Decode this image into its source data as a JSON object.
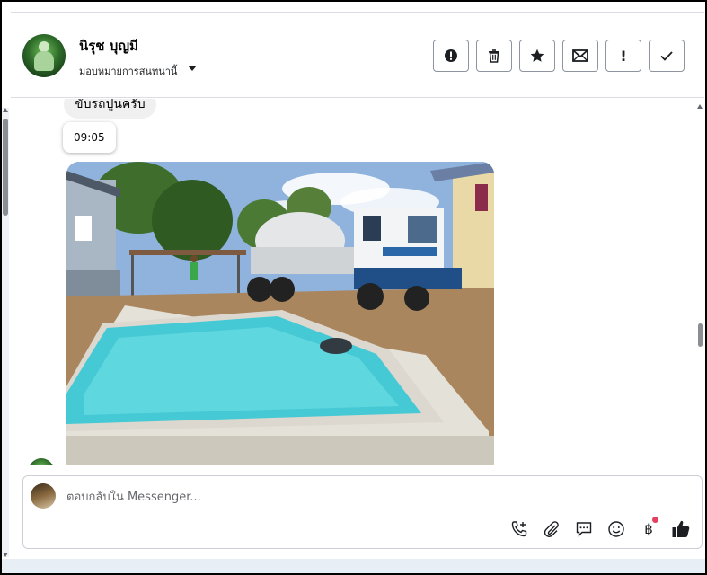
{
  "contact": {
    "name": "นิรุช บุญมี",
    "assign_label": "มอบหมายการสนทนานี้"
  },
  "header_actions": [
    {
      "name": "alert-circle-button",
      "icon": "alert-circle-icon"
    },
    {
      "name": "delete-button",
      "icon": "trash-icon"
    },
    {
      "name": "star-button",
      "icon": "star-icon"
    },
    {
      "name": "mail-button",
      "icon": "envelope-icon"
    },
    {
      "name": "mark-important-button",
      "icon": "exclamation-icon",
      "glyph": "!"
    },
    {
      "name": "mark-done-button",
      "icon": "check-icon"
    }
  ],
  "messages": {
    "text": "ขับรถปูนครับ",
    "timestamp": "09:05",
    "photo_description_icon": "image-photo"
  },
  "composer": {
    "placeholder": "ตอบกลับใน Messenger...",
    "tools": [
      {
        "name": "call-add-button",
        "icon": "phone-plus-icon"
      },
      {
        "name": "attach-button",
        "icon": "paperclip-icon"
      },
      {
        "name": "saved-replies-button",
        "icon": "chat-bubble-icon"
      },
      {
        "name": "emoji-button",
        "icon": "smiley-icon"
      },
      {
        "name": "payment-button",
        "icon": "baht-icon",
        "glyph": "฿"
      },
      {
        "name": "like-button",
        "icon": "thumbs-up-icon"
      }
    ]
  },
  "colors": {
    "border": "#8d949e",
    "bubble_bg": "#f0f0f0",
    "badge_red": "#e4405f"
  }
}
